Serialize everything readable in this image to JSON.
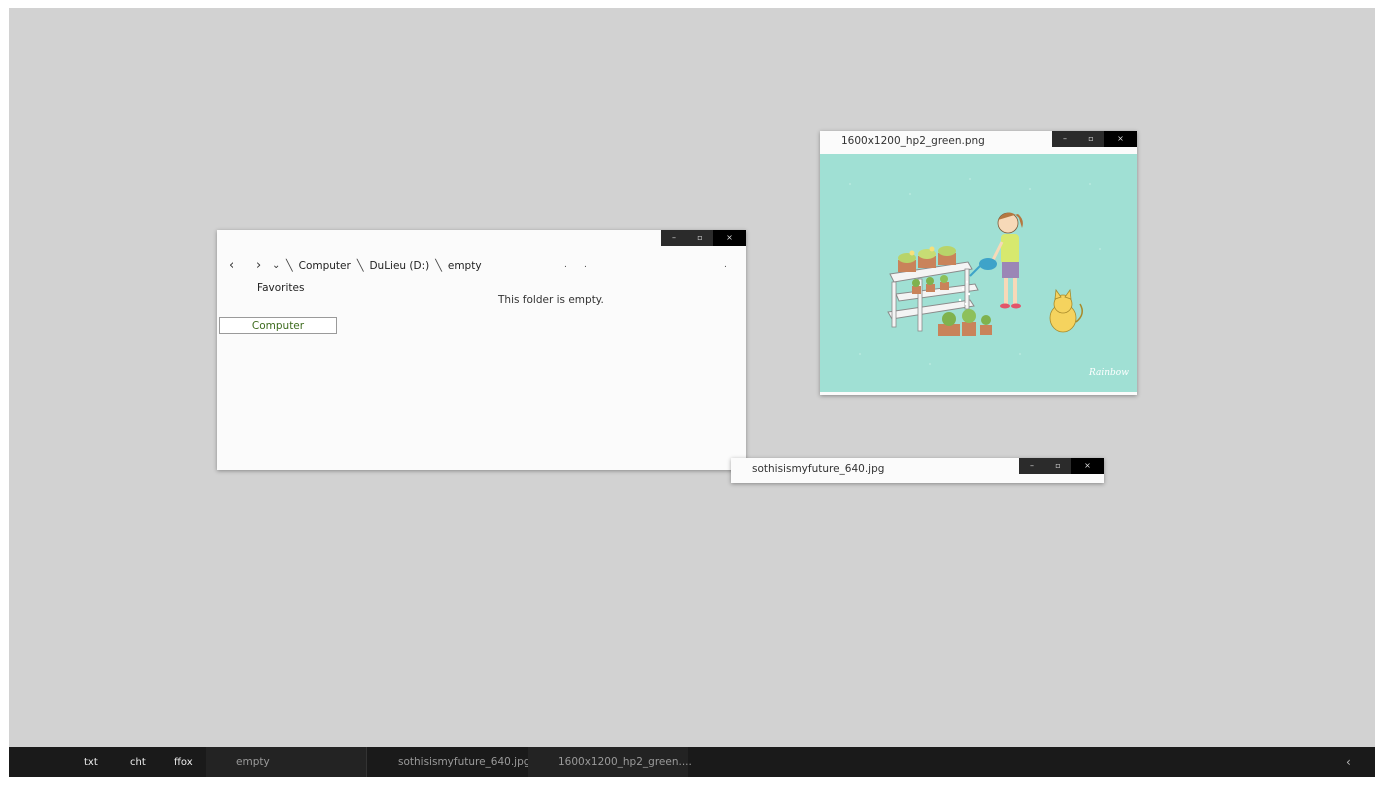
{
  "explorer": {
    "controls": {
      "minimize": "–",
      "maximize": "▫",
      "close": "×"
    },
    "nav": {
      "back": "‹",
      "forward": "›",
      "dropdown": "⌄"
    },
    "breadcrumb": [
      {
        "sep": "╲",
        "label": "Computer"
      },
      {
        "sep": "╲",
        "label": "DuLieu (D:)"
      },
      {
        "sep": "╲",
        "label": "empty"
      }
    ],
    "dots": [
      ".",
      ".",
      "."
    ],
    "favorites_label": "Favorites",
    "sidebar_computer": "Computer",
    "empty_message": "This folder is empty."
  },
  "viewer": {
    "title": "1600x1200_hp2_green.png",
    "controls": {
      "minimize": "–",
      "maximize": "▫",
      "close": "×"
    },
    "watermark": "Rainbow"
  },
  "small_window": {
    "title": "sothisismyfuture_640.jpg",
    "controls": {
      "minimize": "–",
      "maximize": "▫",
      "close": "×"
    }
  },
  "taskbar": {
    "quick": [
      "txt",
      "cht",
      "ffox"
    ],
    "tasks": [
      "empty",
      "sothisismyfuture_640.jpg",
      "1600x1200_hp2_green...."
    ],
    "tray_arrow": "‹"
  },
  "colors": {
    "desktop": "#d2d2d2",
    "taskbar": "#1a1a1a",
    "picture_bg": "#a0e0d4",
    "sidebar_text": "#3d6b1e"
  }
}
